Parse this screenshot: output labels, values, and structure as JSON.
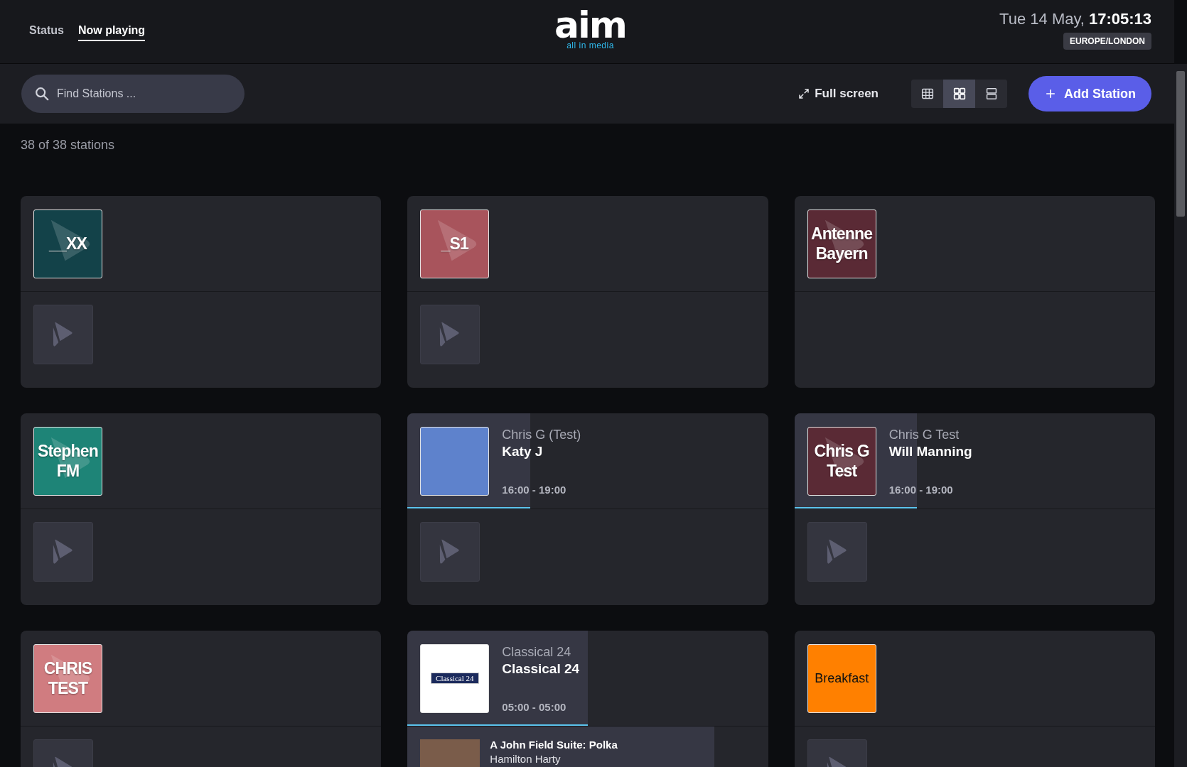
{
  "nav": {
    "tabs": [
      {
        "label": "Status",
        "selected": false
      },
      {
        "label": "Now playing",
        "selected": true
      }
    ]
  },
  "brand": {
    "logo": "aim",
    "tagline": "all in media"
  },
  "clock": {
    "date": "Tue 14 May,",
    "time": "17:05:13",
    "timezone": "EUROPE/LONDON"
  },
  "toolbar": {
    "search": {
      "placeholder": "Find Stations ..."
    },
    "fullscreen": "Full screen",
    "views": [
      {
        "kind": "table",
        "selected": false
      },
      {
        "kind": "grid",
        "selected": true
      },
      {
        "kind": "list",
        "selected": false
      }
    ],
    "add_button": "Add Station"
  },
  "count": "38 of 38 stations",
  "stations": [
    {
      "logo": {
        "kind": "text",
        "text": "__XX",
        "color": "#134249"
      },
      "track": {
        "kind": "placeholder"
      }
    },
    {
      "logo": {
        "kind": "text",
        "text": "_S1",
        "color": "#a8545c"
      },
      "track": {
        "kind": "placeholder"
      }
    },
    {
      "logo": {
        "kind": "text",
        "text": "Antenne Bayern",
        "color": "#5a2a35"
      }
    },
    {
      "logo": {
        "kind": "text",
        "text": "Stephen FM",
        "color": "#1e8477"
      },
      "track": {
        "kind": "placeholder"
      }
    },
    {
      "logo": {
        "kind": "art"
      },
      "show": {
        "station": "Chris G (Test)",
        "title": "Katy J",
        "time": "16:00 - 19:00",
        "level": 0.34
      },
      "track": {
        "kind": "placeholder"
      }
    },
    {
      "logo": {
        "kind": "text",
        "text": "Chris G Test",
        "color": "#5a2a35"
      },
      "show": {
        "station": "Chris G Test",
        "title": "Will Manning",
        "time": "16:00 - 19:00",
        "level": 0.34
      },
      "track": {
        "kind": "placeholder"
      }
    },
    {
      "logo": {
        "kind": "text",
        "text": "CHRIS TEST",
        "color": "#d07c80"
      },
      "track": {
        "kind": "placeholder"
      }
    },
    {
      "logo": {
        "kind": "banner",
        "text": "Classical 24"
      },
      "show": {
        "station": "Classical 24",
        "title": "Classical 24",
        "time": "05:00 - 05:00",
        "level": 0.5
      },
      "track": {
        "kind": "track",
        "title": "A John Field Suite: Polka",
        "artist": "Hamilton Harty",
        "level": 0.85
      }
    },
    {
      "logo": {
        "kind": "plain",
        "text": "Breakfast",
        "color": "#ff8000"
      },
      "track": {
        "kind": "placeholder"
      }
    }
  ]
}
